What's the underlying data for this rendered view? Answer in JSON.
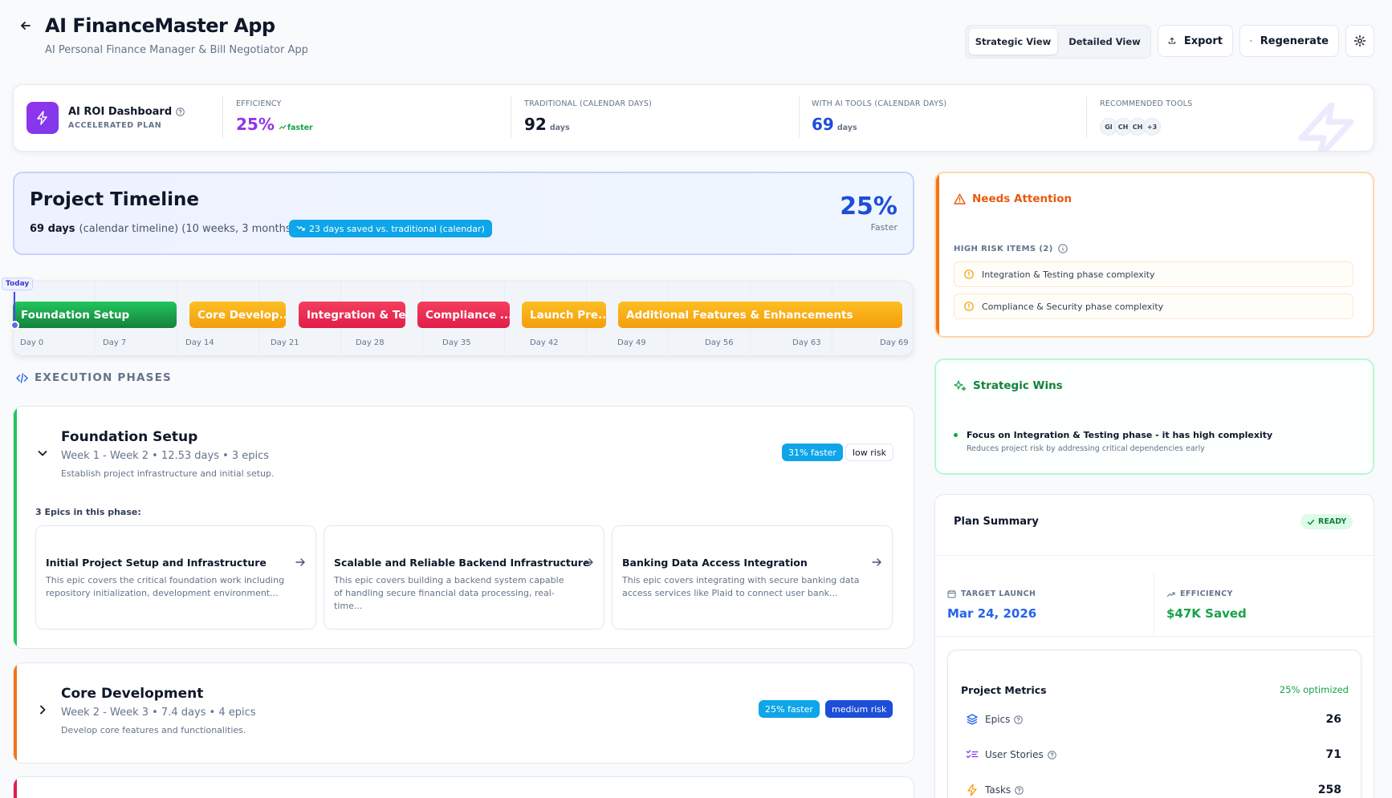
{
  "header": {
    "title": "AI FinanceMaster App",
    "subtitle": "AI Personal Finance Manager & Bill Negotiator App",
    "views": [
      "Strategic View",
      "Detailed View"
    ],
    "export_label": "Export",
    "regenerate_label": "Regenerate"
  },
  "roi": {
    "title": "AI ROI Dashboard",
    "plan": "ACCELERATED PLAN",
    "efficiency_label": "EFFICIENCY",
    "efficiency_value": "25%",
    "efficiency_note": "faster",
    "traditional_label": "TRADITIONAL (CALENDAR DAYS)",
    "traditional_value": "92",
    "traditional_unit": "days",
    "ai_label": "WITH AI TOOLS (CALENDAR DAYS)",
    "ai_value": "69",
    "ai_unit": "days",
    "tools_label": "RECOMMENDED TOOLS",
    "tools": [
      "GI",
      "CH",
      "CH",
      "+3"
    ]
  },
  "timeline": {
    "title": "Project Timeline",
    "days": "69 days",
    "detail": "(calendar timeline) (10 weeks, 3 months)",
    "saved_badge": "23 days saved vs. traditional (calendar)",
    "percent": "25%",
    "percent_label": "Faster",
    "today_label": "Today",
    "bars": [
      {
        "label": "Foundation Setup",
        "color": "#16a34a"
      },
      {
        "label": "Core Develop...",
        "color": "#f59e0b"
      },
      {
        "label": "Integration & Te...",
        "color": "#e11d48"
      },
      {
        "label": "Compliance ...",
        "color": "#e11d48"
      },
      {
        "label": "Launch Pre...",
        "color": "#f59e0b"
      },
      {
        "label": "Additional Features & Enhancements",
        "color": "#f59e0b"
      }
    ],
    "day_labels": [
      "Day 0",
      "Day 7",
      "Day 14",
      "Day 21",
      "Day 28",
      "Day 35",
      "Day 42",
      "Day 49",
      "Day 56",
      "Day 63",
      "Day 69"
    ]
  },
  "execution": {
    "heading": "EXECUTION PHASES",
    "phases": [
      {
        "title": "Foundation Setup",
        "meta": "Week 1 - Week 2 • 12.53 days • 3 epics",
        "desc": "Establish project infrastructure and initial setup.",
        "speed": "31% faster",
        "risk": "low risk",
        "epics_label": "3 Epics in this phase:",
        "epics": [
          {
            "title": "Initial Project Setup and Infrastructure",
            "desc": "This epic covers the critical foundation work including repository initialization, development environment..."
          },
          {
            "title": "Scalable and Reliable Backend Infrastructure",
            "desc": "This epic covers building a backend system capable of handling secure financial data processing, real-time..."
          },
          {
            "title": "Banking Data Access Integration",
            "desc": "This epic covers integrating with secure banking data access services like Plaid to connect user bank..."
          }
        ]
      },
      {
        "title": "Core Development",
        "meta": "Week 2 - Week 3 • 7.4 days • 4 epics",
        "desc": "Develop core features and functionalities.",
        "speed": "25% faster",
        "risk": "medium risk"
      }
    ]
  },
  "attention": {
    "title": "Needs Attention",
    "high_risk_label": "HIGH RISK ITEMS (2)",
    "items": [
      "Integration & Testing phase complexity",
      "Compliance & Security phase complexity"
    ]
  },
  "wins": {
    "title": "Strategic Wins",
    "item_title": "Focus on Integration & Testing phase - it has high complexity",
    "item_desc": "Reduces project risk by addressing critical dependencies early"
  },
  "summary": {
    "title": "Plan Summary",
    "status": "READY",
    "launch_label": "TARGET LAUNCH",
    "launch_value": "Mar 24, 2026",
    "eff_label": "EFFICIENCY",
    "eff_value": "$47K Saved",
    "metrics_title": "Project Metrics",
    "metrics_note": "25% optimized",
    "metrics": [
      {
        "label": "Epics",
        "value": "26"
      },
      {
        "label": "User Stories",
        "value": "71"
      },
      {
        "label": "Tasks",
        "value": "258"
      }
    ]
  },
  "colors": {
    "accent": "#7c3aed",
    "blue": "#1d4ed8",
    "green": "#16a34a",
    "orange": "#ea580c",
    "red": "#e11d48",
    "amber": "#f59e0b",
    "sky": "#0ea5e9"
  }
}
